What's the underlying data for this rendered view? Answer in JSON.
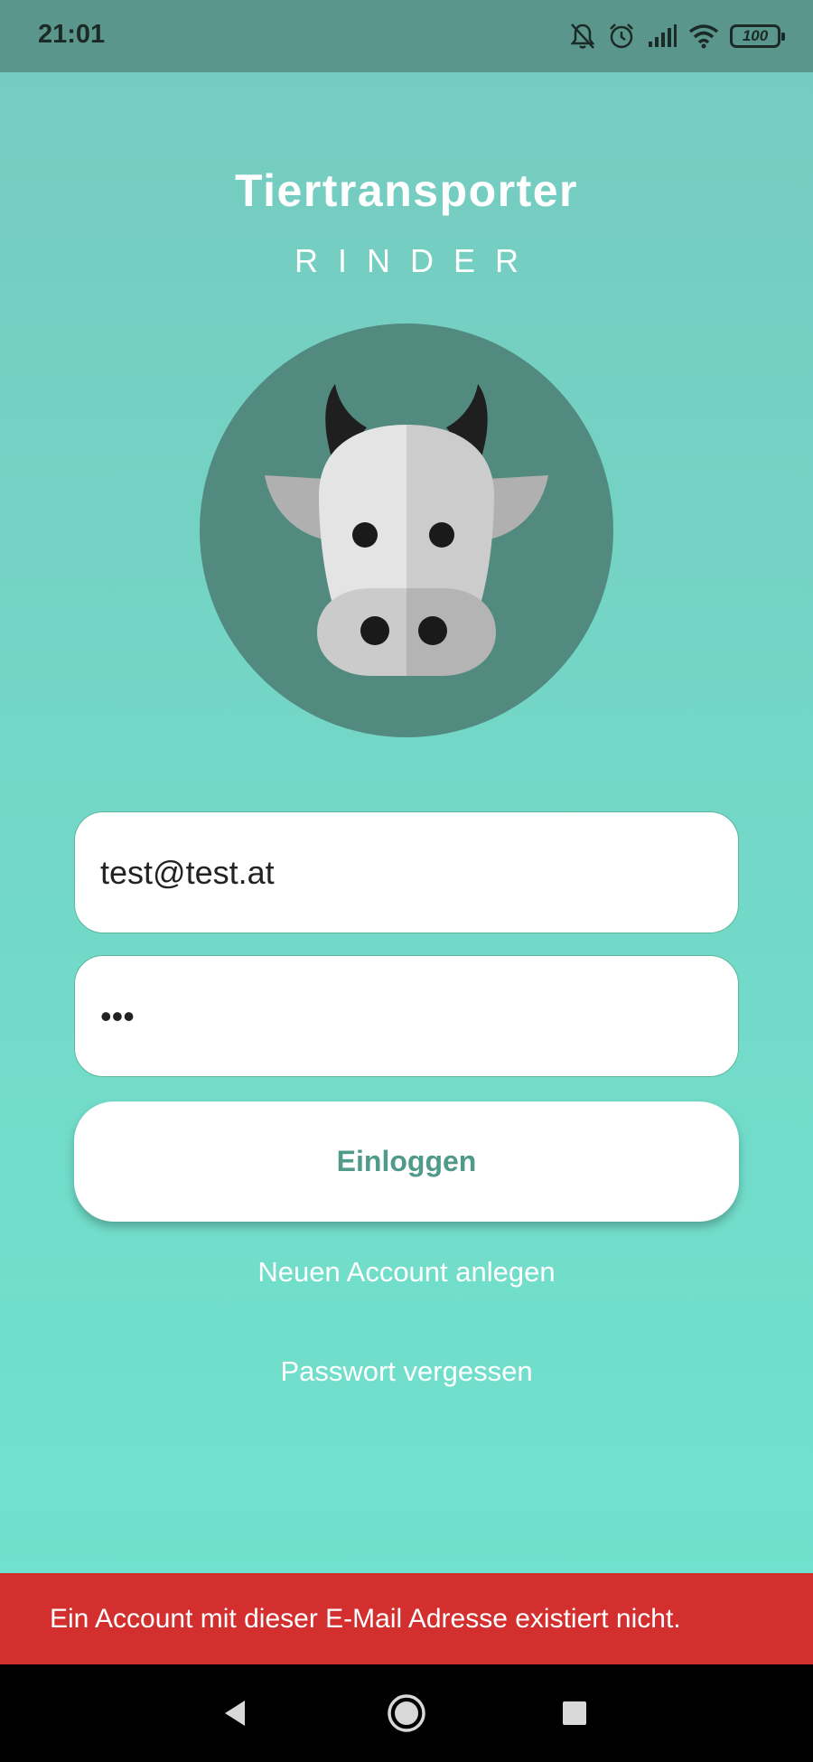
{
  "status_bar": {
    "time": "21:01",
    "battery_level": "100",
    "icons": [
      "bell-off-icon",
      "alarm-icon",
      "signal-icon",
      "wifi-icon",
      "battery-icon"
    ]
  },
  "header": {
    "title": "Tiertransporter",
    "subtitle": "RINDER"
  },
  "logo": {
    "icon": "cow-icon",
    "circle_color": "#528a7f"
  },
  "form": {
    "email_value": "test@test.at",
    "password_value": "•••",
    "login_label": "Einloggen"
  },
  "links": {
    "create_account": "Neuen Account anlegen",
    "forgot_password": "Passwort vergessen"
  },
  "snackbar": {
    "message": "Ein Account mit dieser E-Mail Adresse existiert nicht.",
    "color": "#d32f2f"
  },
  "colors": {
    "accent": "#4f9a8a",
    "background_top": "#76cabf",
    "background_bottom": "#70e3ce",
    "status_bar": "#5a968b"
  }
}
